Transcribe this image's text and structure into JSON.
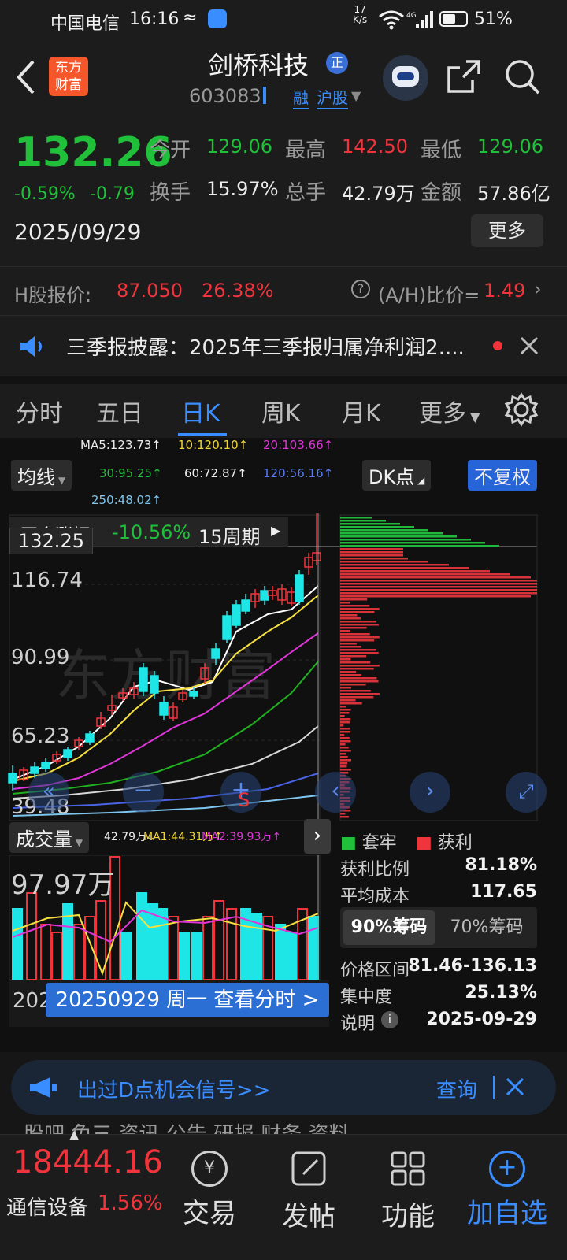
{
  "status_bar": {
    "carrier": "中国电信",
    "time": "16:16",
    "net_speed_top": "17",
    "net_speed_bottom": "K/s",
    "battery": "51%"
  },
  "header": {
    "stock_name": "剑桥科技",
    "badge": "正",
    "code": "603083",
    "tag_margin": "融",
    "tag_market": "沪股"
  },
  "logo": {
    "line1": "东方",
    "line2": "财富"
  },
  "quote": {
    "price": "132.26",
    "change_pct": "-0.59%",
    "change": "-0.79",
    "date": "2025/09/29",
    "open_label": "今开",
    "open": "129.06",
    "high_label": "最高",
    "high": "142.50",
    "low_label": "最低",
    "low": "129.06",
    "turnover_label": "换手",
    "turnover": "15.97%",
    "volume_label": "总手",
    "volume": "42.79万",
    "amount_label": "金额",
    "amount": "57.86亿",
    "more_button": "更多"
  },
  "h_share": {
    "label": "H股报价:",
    "price": "87.050",
    "premium": "26.38%",
    "ah_label": "(A/H)比价=",
    "ah_value": "1.49"
  },
  "notice": {
    "text": "三季报披露：2025年三季报归属净利润2...."
  },
  "tabs": [
    "分时",
    "五日",
    "日K",
    "周K",
    "月K",
    "更多"
  ],
  "active_tab": "日K",
  "chart": {
    "ma_labels": {
      "ma5": "MA5:123.73↑",
      "ma10": "10:120.10↑",
      "ma20": "20:103.66↑",
      "ma30": "30:95.25↑",
      "ma60": "60:72.87↑",
      "ma120": "120:56.16↑",
      "ma250": "250:48.02↑"
    },
    "ma_dropdown": "均线",
    "dk_button": "DK点",
    "fq_button": "不复权",
    "range_label": "至今涨幅",
    "range_value": "-10.56%",
    "period": "15周期",
    "crosshair_price": "132.25",
    "y_ticks": [
      "116.74",
      "90.99",
      "65.23",
      "39.48"
    ],
    "volume_label": "成交量",
    "vol_info": "42.79万↓",
    "vol_ma1": "MA1:44.31万↑",
    "vol_ma2": "MA2:39.93万↑",
    "vol_max": "97.97万",
    "date_year_prefix": "202",
    "timeshare_tip": "20250929 周一 查看分时 >",
    "s_marker": "S",
    "colors": {
      "up": "#f0343c",
      "down": "#1fe6e6",
      "ma5": "#ffffff",
      "ma10": "#f5e040",
      "ma20": "#e035d8",
      "ma30": "#20b020",
      "ma60": "#d8d8d8",
      "ma120": "#4a64e8",
      "ma250": "#7ec6f0"
    }
  },
  "chips": {
    "legend_trapped": "套牢",
    "legend_profit": "获利",
    "profit_ratio_label": "获利比例",
    "profit_ratio": "81.18%",
    "avg_cost_label": "平均成本",
    "avg_cost": "117.65",
    "tab90": "90%筹码",
    "tab70": "70%筹码",
    "range_label": "价格区间",
    "range": "81.46-136.13",
    "concentration_label": "集中度",
    "concentration": "25.13%",
    "note_label": "说明",
    "note_date": "2025-09-29"
  },
  "banner": {
    "text": "出过D点机会信号>>",
    "button": "查询"
  },
  "bottom_tabs_partial": [
    "股吧",
    "免三",
    "资讯",
    "公告",
    "研报",
    "财务",
    "资料"
  ],
  "bottom": {
    "index_value": "18444.16",
    "index_name": "通信设备",
    "index_change": "1.56%",
    "nav": [
      "交易",
      "发帖",
      "功能",
      "加自选"
    ]
  }
}
